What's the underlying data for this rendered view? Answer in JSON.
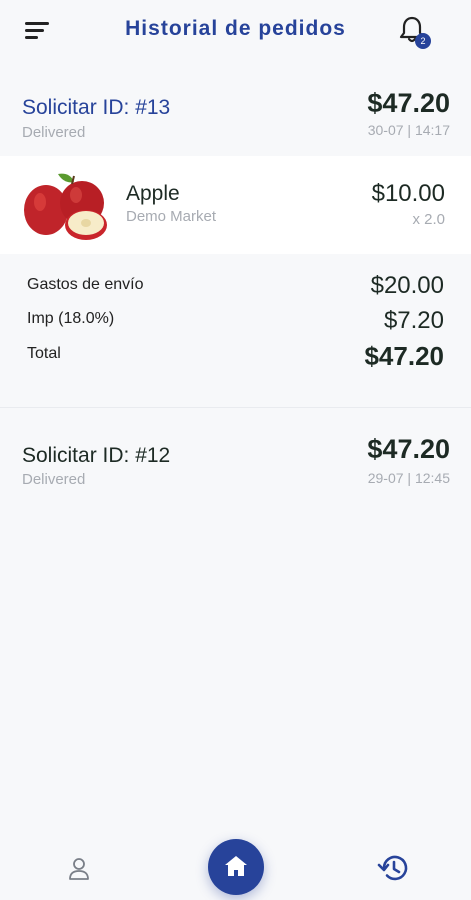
{
  "header": {
    "title": "Historial de pedidos",
    "notification_count": "2"
  },
  "orders": [
    {
      "id_label": "Solicitar ID: #13",
      "status": "Delivered",
      "total": "$47.20",
      "date": "30-07 | 14:17",
      "expanded": true,
      "items": [
        {
          "name": "Apple",
          "store": "Demo Market",
          "price": "$10.00",
          "quantity": "x 2.0"
        }
      ],
      "summary": {
        "shipping_label": "Gastos de envío",
        "shipping_value": "$20.00",
        "tax_label": "Imp (18.0%)",
        "tax_value": "$7.20",
        "total_label": "Total",
        "total_value": "$47.20"
      }
    },
    {
      "id_label": "Solicitar ID: #12",
      "status": "Delivered",
      "total": "$47.20",
      "date": "29-07 | 12:45",
      "expanded": false
    }
  ],
  "bottom_nav": {
    "items": [
      "profile-icon",
      "home-icon",
      "history-icon"
    ],
    "active": "home"
  },
  "colors": {
    "primary": "#27439a",
    "text_dark": "#1d2a24",
    "text_muted": "#a7abb2",
    "background": "#f7f8fa"
  }
}
